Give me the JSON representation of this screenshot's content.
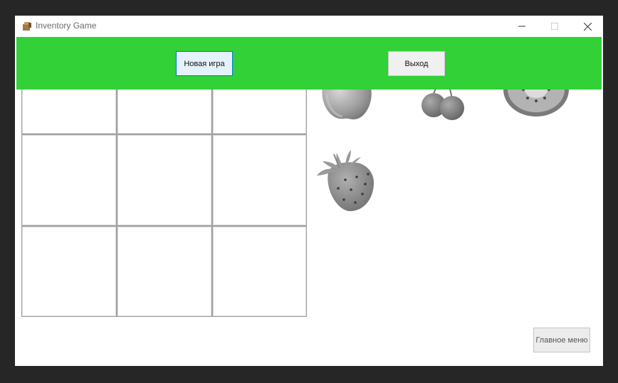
{
  "window": {
    "title": "Inventory Game",
    "icon": "app-icon",
    "controls": [
      "minimize-icon",
      "maximize-icon",
      "close-icon"
    ]
  },
  "toolbar": {
    "new_game_label": "Новая игра",
    "exit_label": "Выход",
    "background_color": "#31d137"
  },
  "inventory": {
    "rows": 3,
    "cols": 3,
    "cells": [
      "",
      "",
      "",
      "",
      "",
      "",
      "",
      "",
      ""
    ]
  },
  "items": [
    {
      "name": "apple-icon"
    },
    {
      "name": "cherry-icon"
    },
    {
      "name": "kiwi-icon"
    },
    {
      "name": "strawberry-icon"
    }
  ],
  "footer": {
    "main_menu_label": "Главное меню"
  }
}
